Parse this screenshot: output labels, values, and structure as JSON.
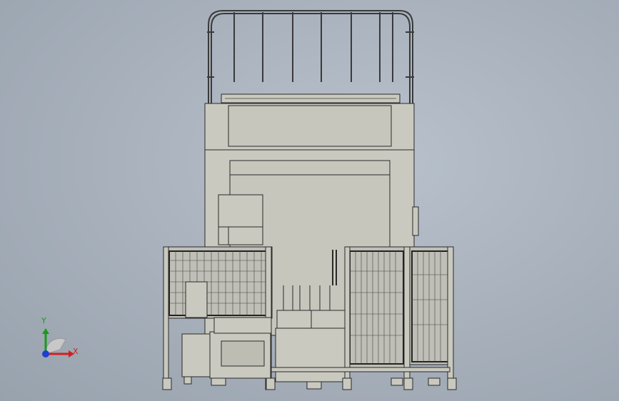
{
  "viewport": {
    "background_color": "#a6afba",
    "model_fill": "#c9c9c0",
    "edge_color": "#2a2a2a"
  },
  "triad": {
    "x_label": "X",
    "y_label": "Y",
    "x_color": "#d02020",
    "y_color": "#1a9a1a",
    "z_color": "#1f3fd0"
  }
}
